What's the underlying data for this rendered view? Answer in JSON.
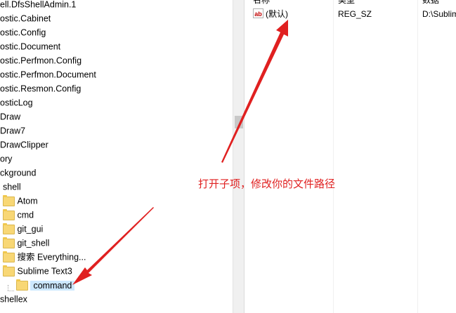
{
  "tree": {
    "items": [
      {
        "label": "ell.DfsShellAdmin.1",
        "indent": "0",
        "folder": false
      },
      {
        "label": "ostic.Cabinet",
        "indent": "0",
        "folder": false
      },
      {
        "label": "ostic.Config",
        "indent": "0",
        "folder": false
      },
      {
        "label": "ostic.Document",
        "indent": "0",
        "folder": false
      },
      {
        "label": "ostic.Perfmon.Config",
        "indent": "0",
        "folder": false
      },
      {
        "label": "ostic.Perfmon.Document",
        "indent": "0",
        "folder": false
      },
      {
        "label": "ostic.Resmon.Config",
        "indent": "0",
        "folder": false
      },
      {
        "label": "osticLog",
        "indent": "0",
        "folder": false
      },
      {
        "label": "Draw",
        "indent": "0",
        "folder": false
      },
      {
        "label": "Draw7",
        "indent": "0",
        "folder": false
      },
      {
        "label": "DrawClipper",
        "indent": "0",
        "folder": false
      },
      {
        "label": "ory",
        "indent": "0",
        "folder": false
      },
      {
        "label": "ckground",
        "indent": "0",
        "folder": false
      },
      {
        "label": "shell",
        "indent": "1",
        "folder": false
      },
      {
        "label": "Atom",
        "indent": "1",
        "folder": true
      },
      {
        "label": "cmd",
        "indent": "1",
        "folder": true
      },
      {
        "label": "git_gui",
        "indent": "1",
        "folder": true
      },
      {
        "label": "git_shell",
        "indent": "1",
        "folder": true
      },
      {
        "label": "搜索 Everything...",
        "indent": "1",
        "folder": true
      },
      {
        "label": "Sublime Text3",
        "indent": "1",
        "folder": true
      },
      {
        "label": "command",
        "indent": "2",
        "folder": true,
        "selected": true
      },
      {
        "label": "shellex",
        "indent": "0",
        "folder": false
      }
    ]
  },
  "list": {
    "headers": {
      "name": "名称",
      "type": "类型",
      "data": "数据"
    },
    "row": {
      "name": "(默认)",
      "type": "REG_SZ",
      "data": "D:\\Sublim",
      "icon": "ab"
    }
  },
  "annotation": {
    "text": "打开子项，修改你的文件路径",
    "color": "#e02020"
  }
}
